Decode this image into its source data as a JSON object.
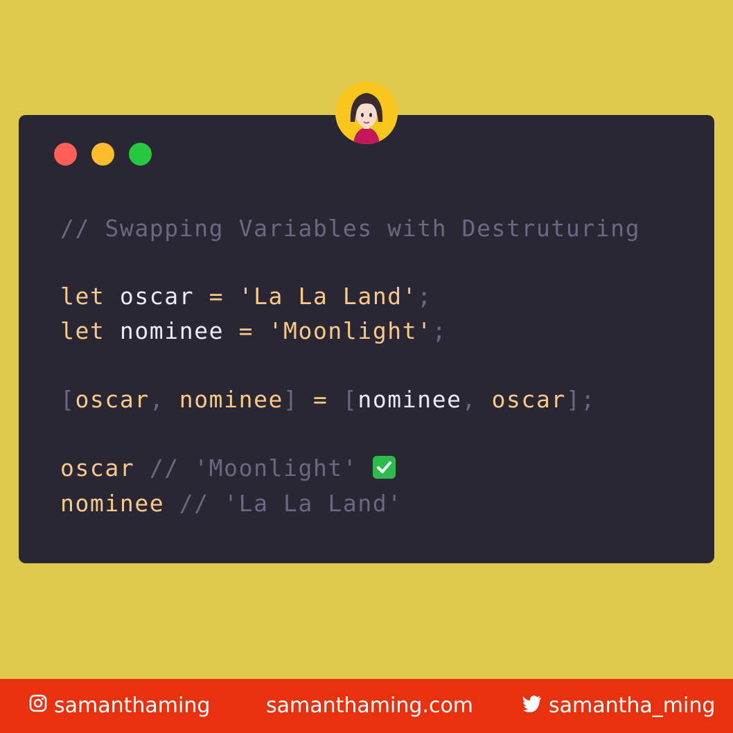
{
  "window": {
    "traffic_lights": {
      "close_color": "#FE5F57",
      "minimize_color": "#FDBC2E",
      "zoom_color": "#27C840"
    }
  },
  "avatar": {
    "icon": "woman-avatar-icon"
  },
  "code": {
    "comment": "// Swapping Variables with Destruturing",
    "line1": {
      "keyword": "let",
      "name": "oscar",
      "op": "=",
      "value": "'La La Land'",
      "end": ";"
    },
    "line2": {
      "keyword": "let",
      "name": "nominee",
      "op": "=",
      "value": "'Moonlight'",
      "end": ";"
    },
    "line3": {
      "open": "[",
      "a": "oscar",
      "comma1": ",",
      "b": "nominee",
      "close": "]",
      "op": "=",
      "open2": "[",
      "c": "nominee",
      "comma2": ",",
      "d": "oscar",
      "close2": "];"
    },
    "line4": {
      "name": "oscar",
      "comment": "// 'Moonlight'",
      "icon": "check-mark-icon"
    },
    "line5": {
      "name": "nominee",
      "comment": "// 'La La Land'"
    }
  },
  "footer": {
    "instagram": {
      "icon": "instagram-icon",
      "label": "samanthaming"
    },
    "website": {
      "label": "samanthaming.com"
    },
    "twitter": {
      "icon": "twitter-icon",
      "label": "samantha_ming"
    },
    "background": "#E8310F"
  }
}
